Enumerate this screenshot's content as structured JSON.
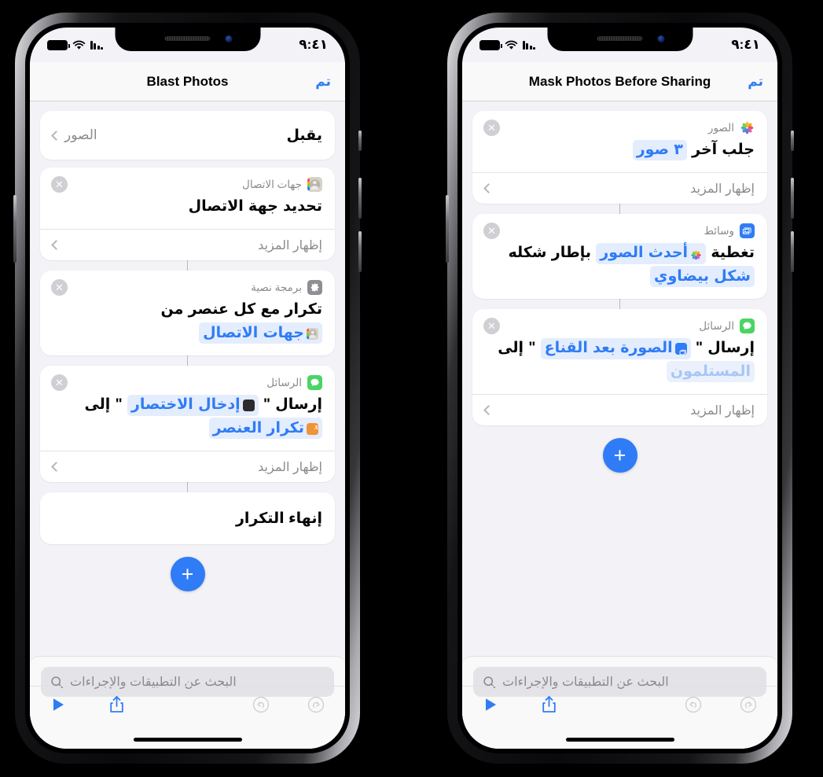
{
  "statusbar": {
    "time": "٩:٤١",
    "battery_icon": "battery-icon",
    "wifi_icon": "wifi-icon",
    "signal_icon": "cellular-signal-icon"
  },
  "shared": {
    "done_label": "تم",
    "show_more_label": "إظهار المزيد",
    "search_placeholder": "البحث عن التطبيقات والإجراءات",
    "add_label": "+",
    "remove_label": "✕",
    "accent_color": "#2f7cf6",
    "token_bg": "#e4edfd",
    "screen_bg": "#f2f2f7"
  },
  "phone_left": {
    "title": "Blast Photos",
    "accept": {
      "label": "يقبل",
      "value": "الصور"
    },
    "cards": [
      {
        "app": "جهات الاتصال",
        "icon": "contacts-icon",
        "parts": [
          {
            "type": "text",
            "text": "تحديد جهة الاتصال"
          }
        ],
        "show_more": true
      },
      {
        "app": "برمجة نصية",
        "icon": "gear-icon",
        "parts": [
          {
            "type": "text",
            "text": "تكرار مع كل عنصر من"
          },
          {
            "type": "token",
            "text": "جهات الاتصال",
            "icon": "contacts-icon"
          }
        ],
        "show_more": false
      },
      {
        "app": "الرسائل",
        "icon": "messages-icon",
        "parts": [
          {
            "type": "text",
            "text": "إرسال \""
          },
          {
            "type": "token",
            "text": "إدخال الاختصار",
            "icon": "shortcut-input-icon"
          },
          {
            "type": "text",
            "text": "\" إلى"
          },
          {
            "type": "token",
            "text": "تكرار العنصر",
            "icon": "variable-icon"
          }
        ],
        "show_more": true
      }
    ],
    "end_repeat": "إنهاء التكرار"
  },
  "phone_right": {
    "title": "Mask Photos Before Sharing",
    "cards": [
      {
        "app": "الصور",
        "icon": "photos-icon",
        "parts": [
          {
            "type": "text",
            "text": "جلب آخر"
          },
          {
            "type": "token",
            "text": "٣ صور"
          }
        ],
        "show_more": true
      },
      {
        "app": "وسائط",
        "icon": "media-icon",
        "parts": [
          {
            "type": "text",
            "text": "تغطية"
          },
          {
            "type": "token",
            "text": "أحدث الصور",
            "icon": "photos-icon"
          },
          {
            "type": "text",
            "text": "بإطار شكله"
          },
          {
            "type": "token",
            "text": "شكل بيضاوي"
          }
        ],
        "show_more": false
      },
      {
        "app": "الرسائل",
        "icon": "messages-icon",
        "parts": [
          {
            "type": "text",
            "text": "إرسال \""
          },
          {
            "type": "token",
            "text": "الصورة بعد القناع",
            "icon": "media-icon"
          },
          {
            "type": "text",
            "text": "\" إلى"
          },
          {
            "type": "token",
            "text": "المستلمون",
            "placeholder": true
          }
        ],
        "show_more": true
      }
    ]
  },
  "toolbar": {
    "play_label": "▶",
    "share_label": "share-icon",
    "undo_label": "undo-icon",
    "redo_label": "redo-icon"
  }
}
